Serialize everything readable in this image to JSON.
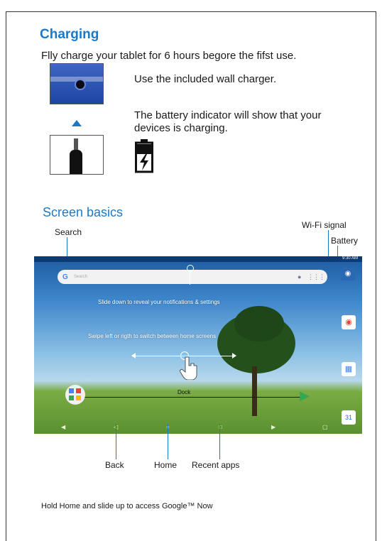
{
  "charging": {
    "title": "Charging",
    "intro": "Flly charge your tablet for 6 hours begore the fifst use.",
    "step1": "Use the included wall charger.",
    "step2_line1": "The battery indicator will show that your",
    "step2_line2": "devices is charging."
  },
  "screen_basics": {
    "title": "Screen basics",
    "labels": {
      "search": "Search",
      "wifi": "Wi-Fi signal",
      "battery": "Battery",
      "back": "Back",
      "home": "Home",
      "recent": "Recent apps"
    },
    "tablet": {
      "time": "9:30 AM",
      "search_placeholder": "Search",
      "slide_down": "Slide down to reveal your notifications & settings",
      "swipe": "Swipe left or rigth to switch between home screens",
      "dock": "Dock"
    }
  },
  "footer": {
    "text": "Hold Home and slide up to access Google™ Now"
  },
  "colors": {
    "accent": "#1a7ac9"
  }
}
